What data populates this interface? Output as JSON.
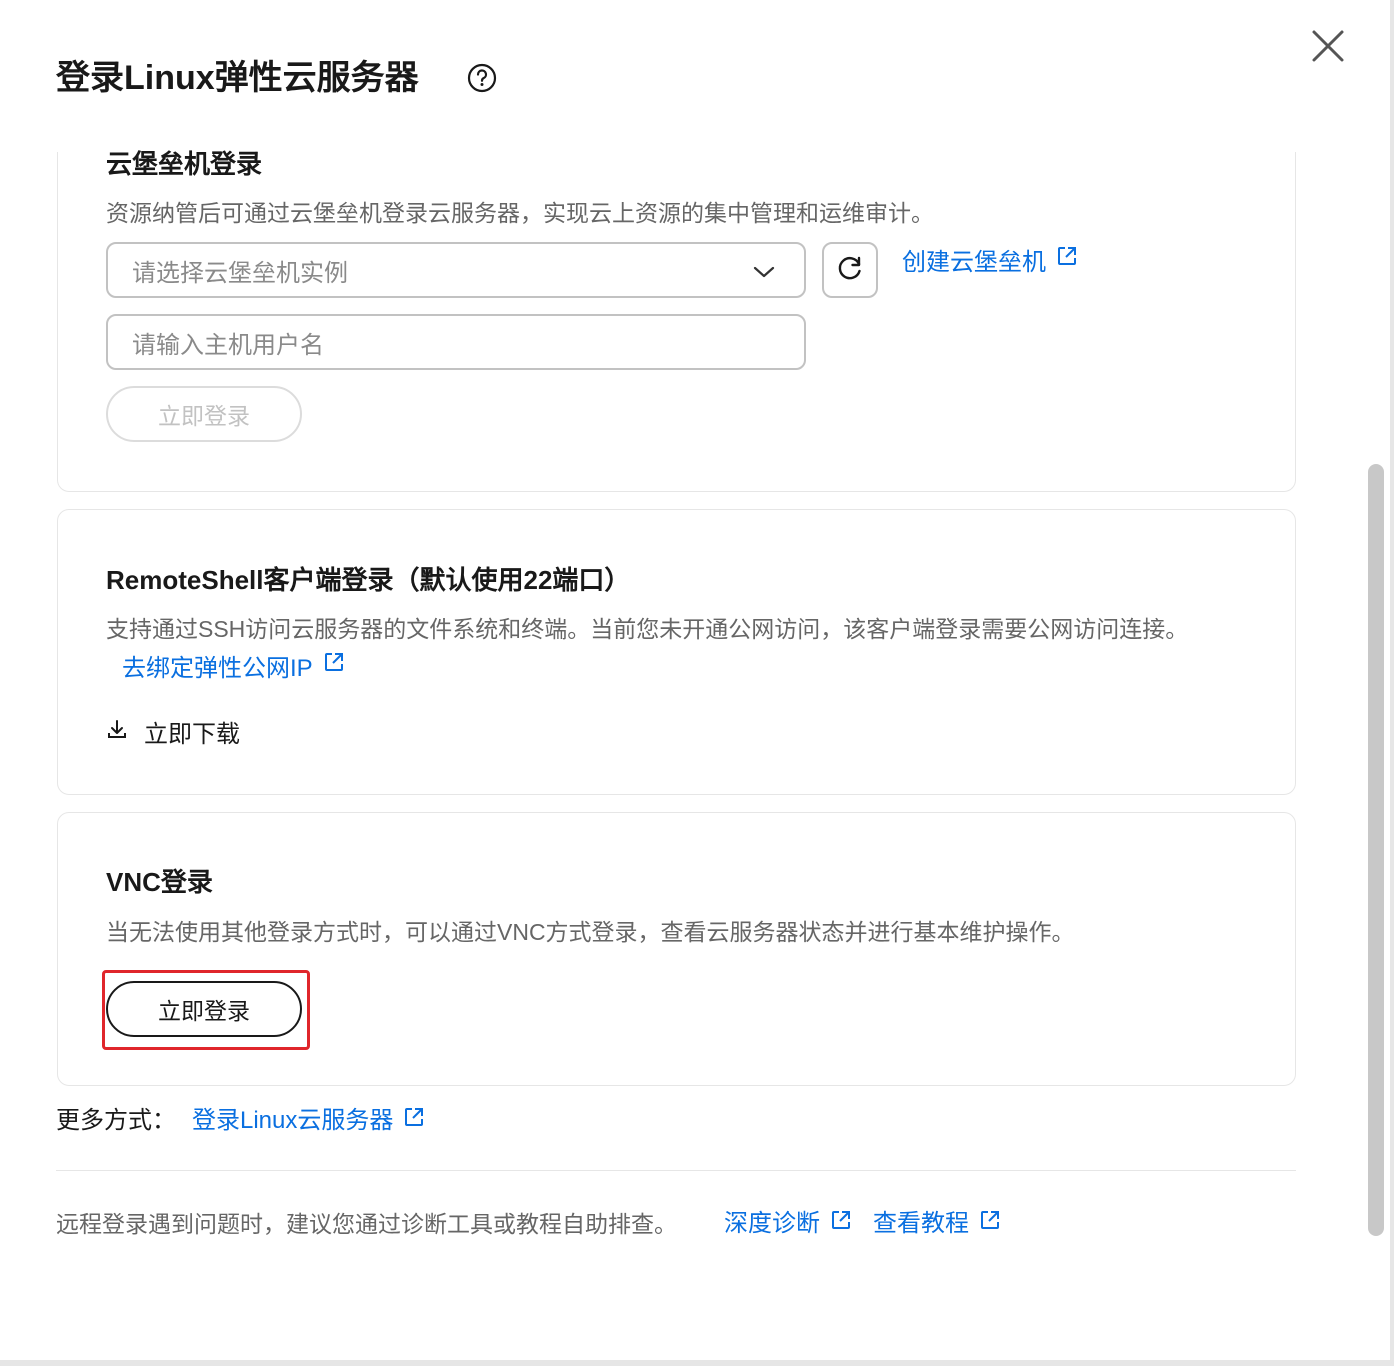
{
  "dialog": {
    "title": "登录Linux弹性云服务器",
    "help_icon": "question-circle-icon",
    "close_icon": "close-icon"
  },
  "bastion": {
    "title": "云堡垒机登录",
    "description": "资源纳管后可通过云堡垒机登录云服务器，实现云上资源的集中管理和运维审计。",
    "select_placeholder": "请选择云堡垒机实例",
    "refresh_icon": "refresh-icon",
    "create_link": "创建云堡垒机",
    "username_placeholder": "请输入主机用户名",
    "login_button": "立即登录"
  },
  "remoteshell": {
    "title": "RemoteShell客户端登录（默认使用22端口）",
    "description": "支持通过SSH访问云服务器的文件系统和终端。当前您未开通公网访问，该客户端登录需要公网访问连接。",
    "bind_link": "去绑定弹性公网IP",
    "download_icon": "download-icon",
    "download_label": "立即下载"
  },
  "vnc": {
    "title": "VNC登录",
    "description": "当无法使用其他登录方式时，可以通过VNC方式登录，查看云服务器状态并进行基本维护操作。",
    "login_button": "立即登录"
  },
  "more": {
    "label": "更多方式：",
    "link": "登录Linux云服务器"
  },
  "footer": {
    "hint": "远程登录遇到问题时，建议您通过诊断工具或教程自助排查。",
    "diagnose_link": "深度诊断",
    "tutorial_link": "查看教程"
  },
  "colors": {
    "link": "#0a6fe0",
    "highlight": "#e0262b",
    "text": "#191919",
    "muted": "#666666",
    "border": "#e6e6e6"
  }
}
